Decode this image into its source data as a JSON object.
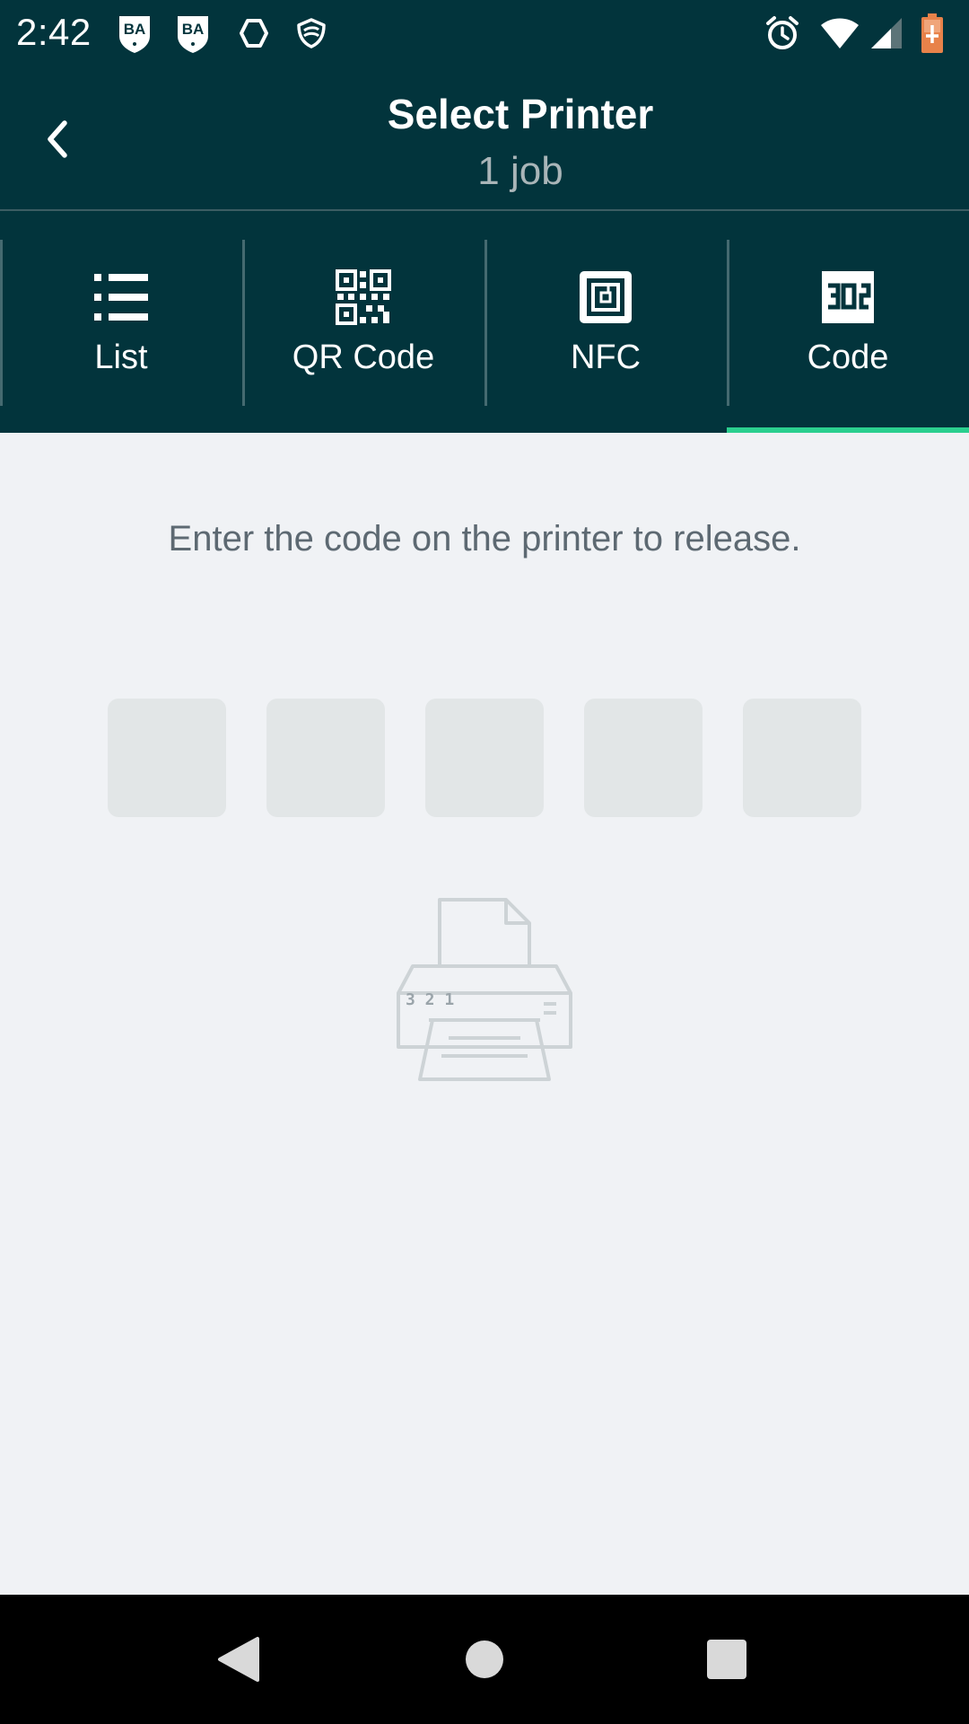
{
  "status_bar": {
    "time": "2:42",
    "notif_badge_1": "BA",
    "notif_badge_2": "BA",
    "icons": [
      "ba-badge-icon",
      "ba-badge-icon",
      "hexagon-icon",
      "shield-swirl-icon",
      "alarm-icon",
      "wifi-icon",
      "cell-signal-icon",
      "battery-charging-icon"
    ]
  },
  "header": {
    "title": "Select Printer",
    "subtitle": "1 job"
  },
  "tabs": [
    {
      "label": "List",
      "icon": "list-icon",
      "selected": false
    },
    {
      "label": "QR Code",
      "icon": "qr-code-icon",
      "selected": false
    },
    {
      "label": "NFC",
      "icon": "nfc-icon",
      "selected": false
    },
    {
      "label": "Code",
      "icon": "code-icon",
      "selected": true
    }
  ],
  "code_entry": {
    "instruction": "Enter the code on the printer to release.",
    "digits": [
      "",
      "",
      "",
      "",
      ""
    ],
    "illustration_code": "3 2 1"
  },
  "colors": {
    "header_bg": "#02343c",
    "accent": "#2bcf8f",
    "page_bg": "#f0f2f5",
    "code_box": "#e2e6e7",
    "instruction_text": "#5d6972"
  },
  "nav_bar": {
    "icons": [
      "back-triangle-icon",
      "home-circle-icon",
      "recents-square-icon"
    ]
  }
}
